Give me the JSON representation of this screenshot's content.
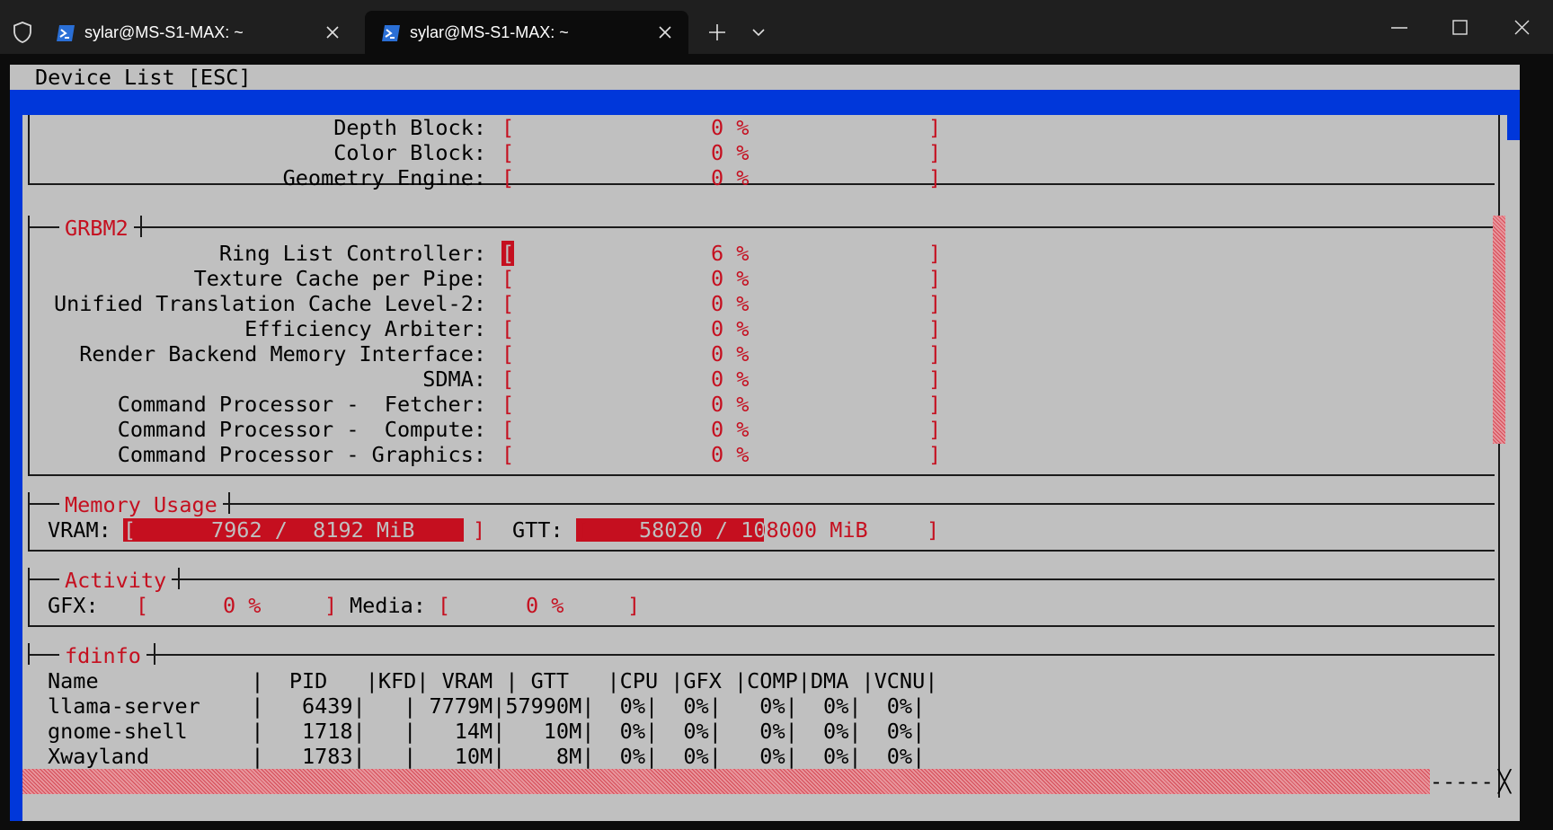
{
  "window": {
    "tabs": [
      {
        "title": "sylar@MS-S1-MAX: ~",
        "active": false
      },
      {
        "title": "sylar@MS-S1-MAX: ~",
        "active": true
      }
    ],
    "buttons": {
      "new_tab": "+",
      "dropdown": "⌄",
      "minimize": "—",
      "maximize": "☐",
      "close": "✕"
    }
  },
  "terminal": {
    "header": "Device List [ESC]",
    "colors": {
      "background": "#c0c0c0",
      "accent_red": "#c50f1f",
      "bar_blue": "#0037da",
      "titlebar": "#1f1f1f"
    },
    "grbm": {
      "rows": [
        {
          "label": "Depth Block:",
          "value": "0 %"
        },
        {
          "label": "Color Block:",
          "value": "0 %"
        },
        {
          "label": "Geometry Engine:",
          "value": "0 %"
        }
      ]
    },
    "grbm2": {
      "title": "GRBM2",
      "rows": [
        {
          "label": "Ring List Controller:",
          "value": "6 %"
        },
        {
          "label": "Texture Cache per Pipe:",
          "value": "0 %"
        },
        {
          "label": "Unified Translation Cache Level-2:",
          "value": "0 %"
        },
        {
          "label": "Efficiency Arbiter:",
          "value": "0 %"
        },
        {
          "label": "Render Backend Memory Interface:",
          "value": "0 %"
        },
        {
          "label": "SDMA:",
          "value": "0 %"
        },
        {
          "label": "Command Processor -  Fetcher:",
          "value": "0 %"
        },
        {
          "label": "Command Processor -  Compute:",
          "value": "0 %"
        },
        {
          "label": "Command Processor - Graphics:",
          "value": "0 %"
        }
      ]
    },
    "memory": {
      "title": "Memory Usage",
      "vram_label": "VRAM:",
      "vram_value": "7962 /  8192 MiB",
      "vram_fill": 0.972,
      "gtt_label": "GTT:",
      "gtt_value": "58020 / 108000 MiB",
      "gtt_fill": 0.537
    },
    "activity": {
      "title": "Activity",
      "gfx_label": "GFX:",
      "gfx_value": "0 %",
      "media_label": "Media:",
      "media_value": "0 %"
    },
    "fdinfo": {
      "title": "fdinfo",
      "header": "Name            |  PID   |KFD| VRAM | GTT   |CPU |GFX |COMP|DMA |VCNU|",
      "rows": [
        "llama-server    |   6439|   | 7779M|57990M|  0%|  0%|   0%|  0%|  0%|",
        "gnome-shell     |   1718|   |   14M|   10M|  0%|  0%|   0%|  0%|  0%|",
        "Xwayland        |   1783|   |   10M|    8M|  0%|  0%|   0%|  0%|  0%|"
      ]
    },
    "scroll_end": "-----"
  }
}
